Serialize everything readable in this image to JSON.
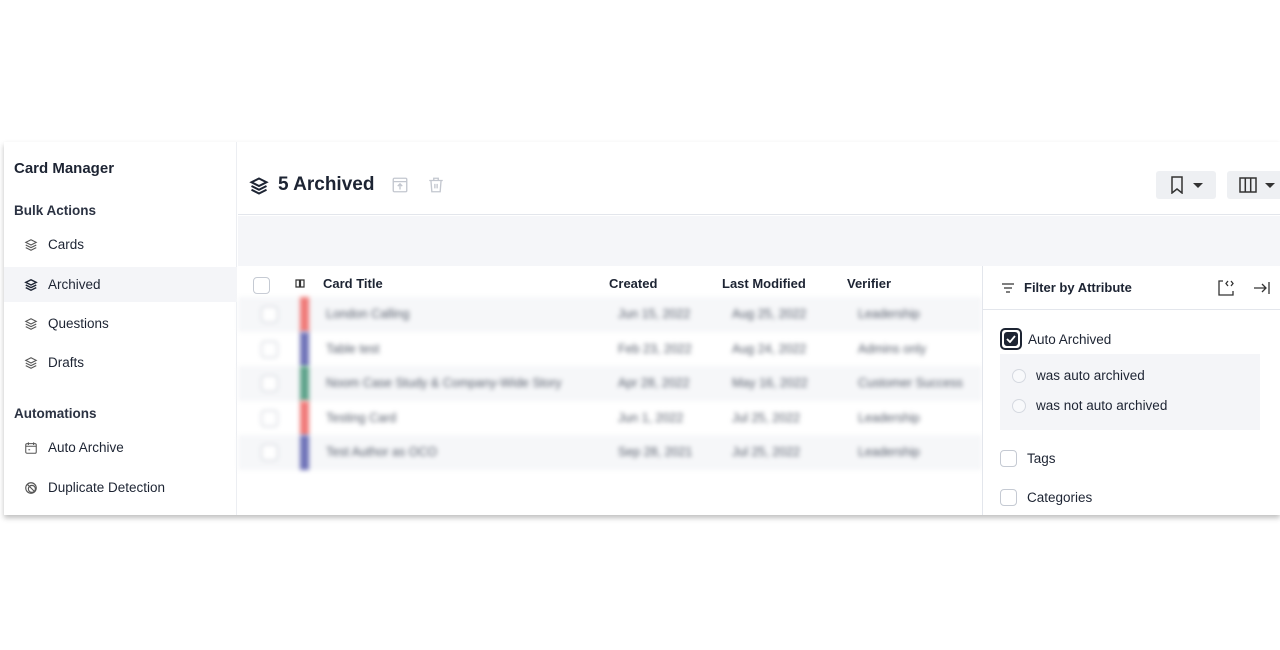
{
  "sidebar": {
    "title": "Card Manager",
    "sections": [
      {
        "label": "Bulk Actions",
        "items": [
          {
            "label": "Cards",
            "icon": "layers-icon"
          },
          {
            "label": "Archived",
            "icon": "layers-icon",
            "active": true
          },
          {
            "label": "Questions",
            "icon": "layers-icon"
          },
          {
            "label": "Drafts",
            "icon": "layers-icon"
          }
        ]
      },
      {
        "label": "Automations",
        "items": [
          {
            "label": "Auto Archive",
            "icon": "calendar-icon"
          },
          {
            "label": "Duplicate Detection",
            "icon": "duplicate-icon"
          }
        ]
      }
    ]
  },
  "header": {
    "title": "5 Archived",
    "icons": [
      "layers-icon",
      "unarchive-icon",
      "trash-icon",
      "bookmark-icon",
      "columns-icon"
    ]
  },
  "table": {
    "columns": [
      "Card Title",
      "Created",
      "Last Modified",
      "Verifier"
    ],
    "rows": [
      {
        "title": "London Calling",
        "created": "Jun 15, 2022",
        "modified": "Aug 25, 2022",
        "verifier": "Leadership",
        "color": "#f07a78"
      },
      {
        "title": "Table test",
        "created": "Feb 23, 2022",
        "modified": "Aug 24, 2022",
        "verifier": "Admins only",
        "color": "#6f73b8"
      },
      {
        "title": "Noom Case Study & Company-Wide Story",
        "created": "Apr 28, 2022",
        "modified": "May 16, 2022",
        "verifier": "Customer Success",
        "color": "#5ea38a"
      },
      {
        "title": "Testing Card",
        "created": "Jun 1, 2022",
        "modified": "Jul 25, 2022",
        "verifier": "Leadership",
        "color": "#f07a78"
      },
      {
        "title": "Test Author as OCO",
        "created": "Sep 28, 2021",
        "modified": "Jul 25, 2022",
        "verifier": "Leadership",
        "color": "#6f73b8"
      }
    ]
  },
  "filter": {
    "title": "Filter by Attribute",
    "auto_archived": {
      "label": "Auto Archived",
      "checked": true,
      "options": [
        "was auto archived",
        "was not auto archived"
      ]
    },
    "tags": {
      "label": "Tags",
      "checked": false
    },
    "categories": {
      "label": "Categories",
      "checked": false
    }
  }
}
